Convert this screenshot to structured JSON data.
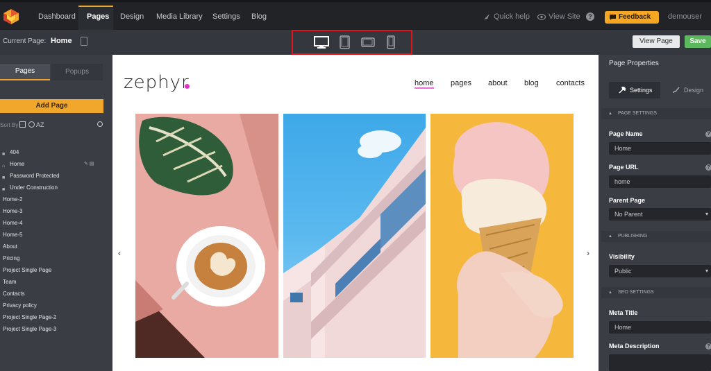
{
  "topbar": {
    "nav": [
      "Dashboard",
      "Pages",
      "Design",
      "Media Library",
      "Settings",
      "Blog"
    ],
    "quick_help": "Quick help",
    "view_site": "View Site",
    "feedback": "Feedback",
    "user": "demouser",
    "accent": "#f0a72c"
  },
  "toolbar": {
    "current_page_label": "Current Page:",
    "current_page_value": "Home",
    "view_page": "View Page",
    "save": "Save",
    "devices": [
      "desktop-icon",
      "tablet-icon",
      "tablet-landscape-icon",
      "mobile-icon"
    ],
    "highlight_color": "#e0151b"
  },
  "leftbar": {
    "tabs": [
      "Pages",
      "Popups"
    ],
    "add_page": "Add Page",
    "sort_by": "Sort By",
    "sort_az": "AZ",
    "pages": [
      {
        "label": "404",
        "icon": "lock-icon"
      },
      {
        "label": "Home",
        "icon": "home-icon",
        "actions": true
      },
      {
        "label": "Password Protected",
        "icon": "lock-icon"
      },
      {
        "label": "Under Construction",
        "icon": "lock-icon"
      },
      {
        "label": "Home-2"
      },
      {
        "label": "Home-3"
      },
      {
        "label": "Home-4"
      },
      {
        "label": "Home-5"
      },
      {
        "label": "About"
      },
      {
        "label": "Pricing"
      },
      {
        "label": "Project Single Page"
      },
      {
        "label": "Team"
      },
      {
        "label": "Contacts"
      },
      {
        "label": "Privacy policy"
      },
      {
        "label": "Project Single Page-2"
      },
      {
        "label": "Project Single Page-3"
      }
    ]
  },
  "site": {
    "logo": "zephyr",
    "nav": [
      "home",
      "pages",
      "about",
      "blog",
      "contacts"
    ],
    "prev": "‹",
    "next": "›"
  },
  "rightbar": {
    "title": "Page Properties",
    "tab_settings": "Settings",
    "tab_design": "Design",
    "section_page_settings": "PAGE SETTINGS",
    "page_name_label": "Page Name",
    "page_name_value": "Home",
    "page_url_label": "Page URL",
    "page_url_value": "home",
    "parent_page_label": "Parent Page",
    "parent_page_value": "No Parent",
    "section_publishing": "PUBLISHING",
    "visibility_label": "Visibility",
    "visibility_value": "Public",
    "section_seo": "SEO SETTINGS",
    "meta_title_label": "Meta Title",
    "meta_title_value": "Home",
    "meta_description_label": "Meta Description"
  }
}
